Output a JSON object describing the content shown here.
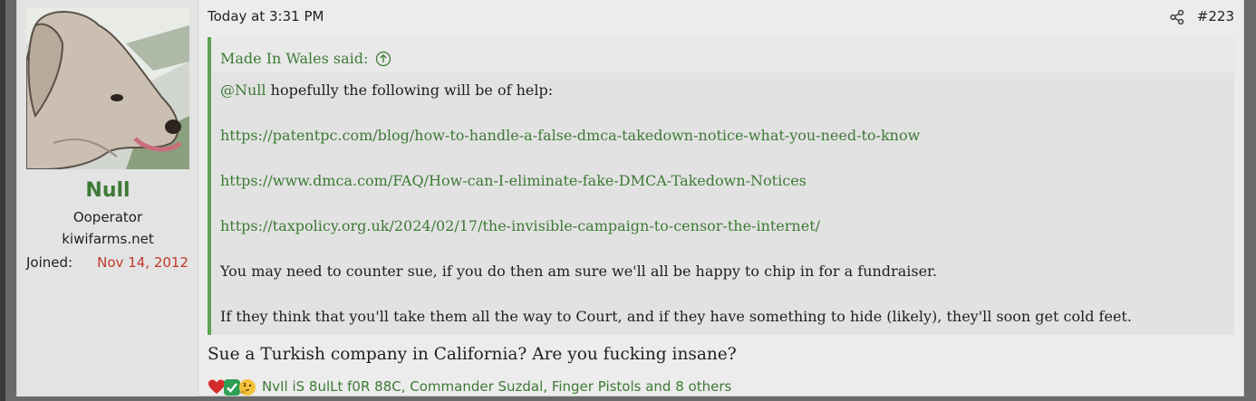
{
  "user": {
    "name": "Null",
    "title": "Ooperator",
    "site": "kiwifarms.net",
    "joined_label": "Joined:",
    "joined_date": "Nov 14, 2012",
    "avatar": "avatar-dog-icon"
  },
  "post": {
    "date": "Today at 3:31 PM",
    "number": "#223",
    "share_icon": "share-icon"
  },
  "quote": {
    "author_line": "Made In Wales said:",
    "mention": "@Null",
    "intro": " hopefully the following will be of help:",
    "links": [
      "https://patentpc.com/blog/how-to-handle-a-false-dmca-takedown-notice-what-you-need-to-know",
      "https://www.dmca.com/FAQ/How-can-I-eliminate-fake-DMCA-Takedown-Notices",
      "https://taxpolicy.org.uk/2024/02/17/the-invisible-campaign-to-censor-the-internet/"
    ],
    "para1": "You may need to counter sue, if you do then am sure we'll all be happy to chip in for a fundraiser.",
    "para2": "If they think that you'll take them all the way to Court, and if they have something to hide (likely), they'll soon get cold feet."
  },
  "reply": "Sue a Turkish company in California? Are you fucking insane?",
  "reactions": {
    "icons": [
      "heart-icon",
      "checkmark-icon",
      "thinking-face-icon"
    ],
    "text": "NvIl iS 8ulLt f0R 88C, Commander Suzdal, Finger Pistols and 8 others"
  },
  "colors": {
    "accent_green": "#3d7a35",
    "quote_bar": "#5fa354",
    "joined_red": "#c0392b"
  }
}
